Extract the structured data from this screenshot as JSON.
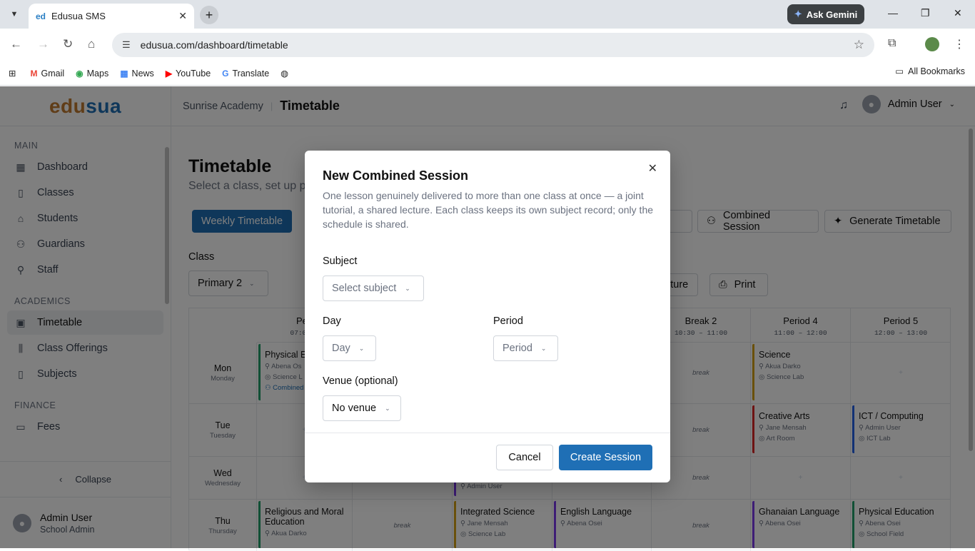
{
  "browser": {
    "tab_title": "Edusua SMS",
    "favicon_text": "ed",
    "ask_gemini": "Ask Gemini",
    "url": "edusua.com/dashboard/timetable",
    "bookmarks": [
      "Gmail",
      "Maps",
      "News",
      "YouTube",
      "Translate"
    ],
    "all_bookmarks": "All Bookmarks"
  },
  "sidebar": {
    "logo_part1": "edu",
    "logo_part2": "sua",
    "sections": {
      "main": "MAIN",
      "academics": "ACADEMICS",
      "finance": "FINANCE"
    },
    "items": {
      "dashboard": "Dashboard",
      "classes": "Classes",
      "students": "Students",
      "guardians": "Guardians",
      "staff": "Staff",
      "timetable": "Timetable",
      "class_offerings": "Class Offerings",
      "subjects": "Subjects",
      "fees": "Fees"
    },
    "collapse": "Collapse",
    "user_name": "Admin User",
    "user_role": "School Admin"
  },
  "topbar": {
    "school": "Sunrise Academy",
    "page": "Timetable",
    "user": "Admin User"
  },
  "page": {
    "title": "Timetable",
    "subtitle": "Select a class, set up p",
    "weekly_btn": "Weekly Timetable",
    "availability_btn": "lity",
    "combined_btn": "Combined Session",
    "generate_btn": "Generate Timetable",
    "class_label": "Class",
    "class_value": "Primary 2",
    "lecture_btn": "cture",
    "print_btn": "Print"
  },
  "grid": {
    "headers": [
      {
        "name": "Peri",
        "time": "07:00 –"
      },
      {
        "name": "Break 2",
        "time": "10:30 – 11:00"
      },
      {
        "name": "Period 4",
        "time": "11:00 – 12:00"
      },
      {
        "name": "Period 5",
        "time": "12:00 – 13:00"
      }
    ],
    "days": [
      {
        "short": "Mon",
        "full": "Monday"
      },
      {
        "short": "Tue",
        "full": "Tuesday"
      },
      {
        "short": "Wed",
        "full": "Wednesday"
      },
      {
        "short": "Thu",
        "full": "Thursday"
      }
    ],
    "break_label": "break",
    "plus": "+",
    "lessons": {
      "mon_p1": {
        "subject": "Physical E",
        "teacher": "Abena Os",
        "venue": "Science L",
        "extra": "Combined"
      },
      "mon_p4": {
        "subject": "Science",
        "teacher": "Akua Darko",
        "venue": "Science Lab"
      },
      "tue_p4": {
        "subject": "Creative Arts",
        "teacher": "Jane Mensah",
        "venue": "Art Room"
      },
      "tue_p5": {
        "subject": "ICT / Computing",
        "teacher": "Admin User",
        "venue": "ICT Lab"
      },
      "wed_p3": {
        "teacher": "Admin User"
      },
      "thu_p1": {
        "subject": "Religious and Moral Education",
        "teacher": "Akua Darko"
      },
      "thu_p3": {
        "subject": "Integrated Science",
        "teacher": "Jane Mensah",
        "venue": "Science Lab"
      },
      "thu_p4b": {
        "subject": "English Language",
        "teacher": "Abena Osei"
      },
      "thu_p4": {
        "subject": "Ghanaian Language",
        "teacher": "Abena Osei"
      },
      "thu_p5": {
        "subject": "Physical Education",
        "teacher": "Abena Osei",
        "venue": "School Field"
      }
    }
  },
  "modal": {
    "title": "New Combined Session",
    "description": "One lesson genuinely delivered to more than one class at once — a joint tutorial, a shared lecture. Each class keeps its own subject record; only the schedule is shared.",
    "subject_label": "Subject",
    "subject_placeholder": "Select subject",
    "day_label": "Day",
    "day_placeholder": "Day",
    "period_label": "Period",
    "period_placeholder": "Period",
    "venue_label": "Venue (optional)",
    "venue_value": "No venue",
    "cancel": "Cancel",
    "create": "Create Session"
  }
}
